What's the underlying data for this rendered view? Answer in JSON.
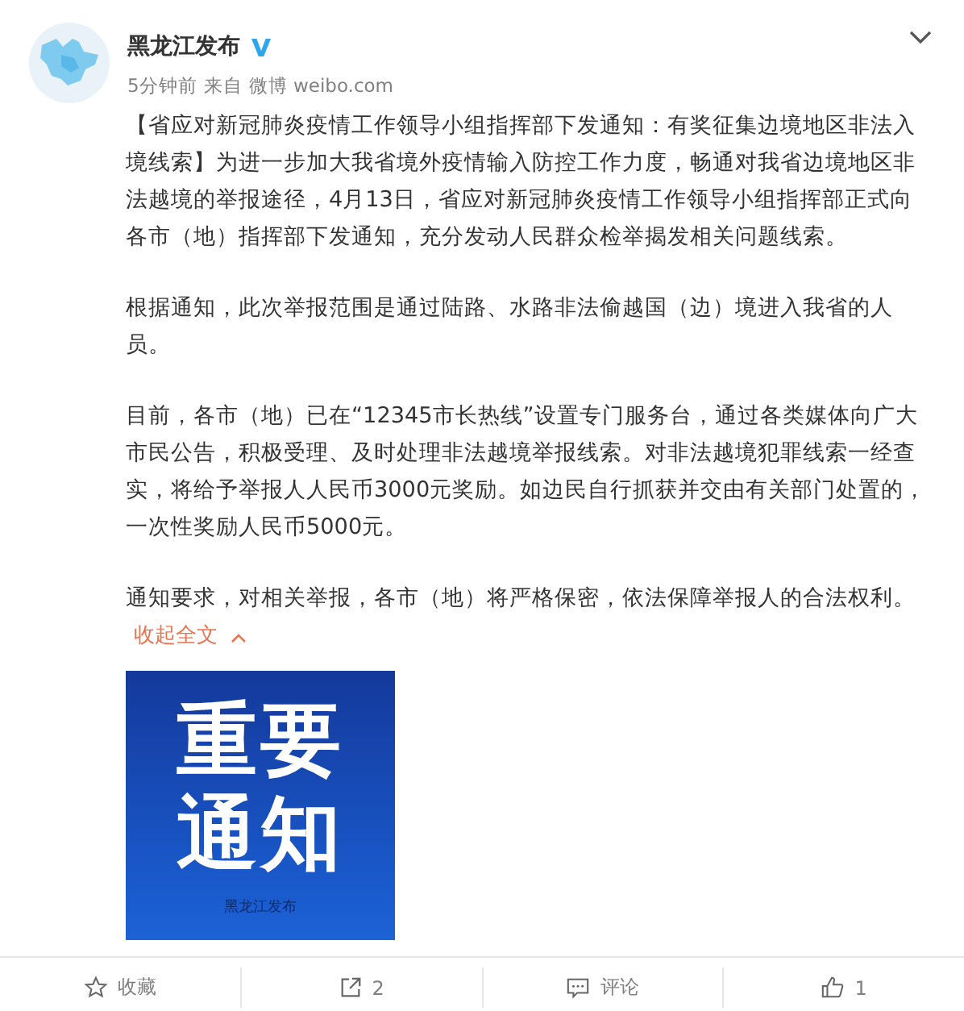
{
  "post": {
    "author": "黑龙江发布",
    "verified": true,
    "time": "5分钟前",
    "source_prefix": "来自",
    "source": "微博 weibo.com",
    "paragraphs": [
      "【省应对新冠肺炎疫情工作领导小组指挥部下发通知：有奖征集边境地区非法入境线索】为进一步加大我省境外疫情输入防控工作力度，畅通对我省边境地区非法越境的举报途径，4月13日，省应对新冠肺炎疫情工作领导小组指挥部正式向各市（地）指挥部下发通知，充分发动人民群众检举揭发相关问题线索。",
      "根据通知，此次举报范围是通过陆路、水路非法偷越国（边）境进入我省的人员。",
      "目前，各市（地）已在“12345市长热线”设置专门服务台，通过各类媒体向广大市民公告，积极受理、及时处理非法越境举报线索。对非法越境犯罪线索一经查实，将给予举报人人民币3000元奖励。如边民自行抓获并交由有关部门处置的，一次性奖励人民币5000元。",
      "通知要求，对相关举报，各市（地）将严格保密，依法保障举报人的合法权利。"
    ],
    "collapse_link": "收起全文",
    "image": {
      "lines": [
        "重要",
        "通知"
      ],
      "caption": "黑龙江发布"
    }
  },
  "actions": [
    {
      "kind": "favorite",
      "label": "收藏"
    },
    {
      "kind": "repost",
      "label": "2"
    },
    {
      "kind": "comment",
      "label": "评论"
    },
    {
      "kind": "like",
      "label": "1"
    }
  ]
}
